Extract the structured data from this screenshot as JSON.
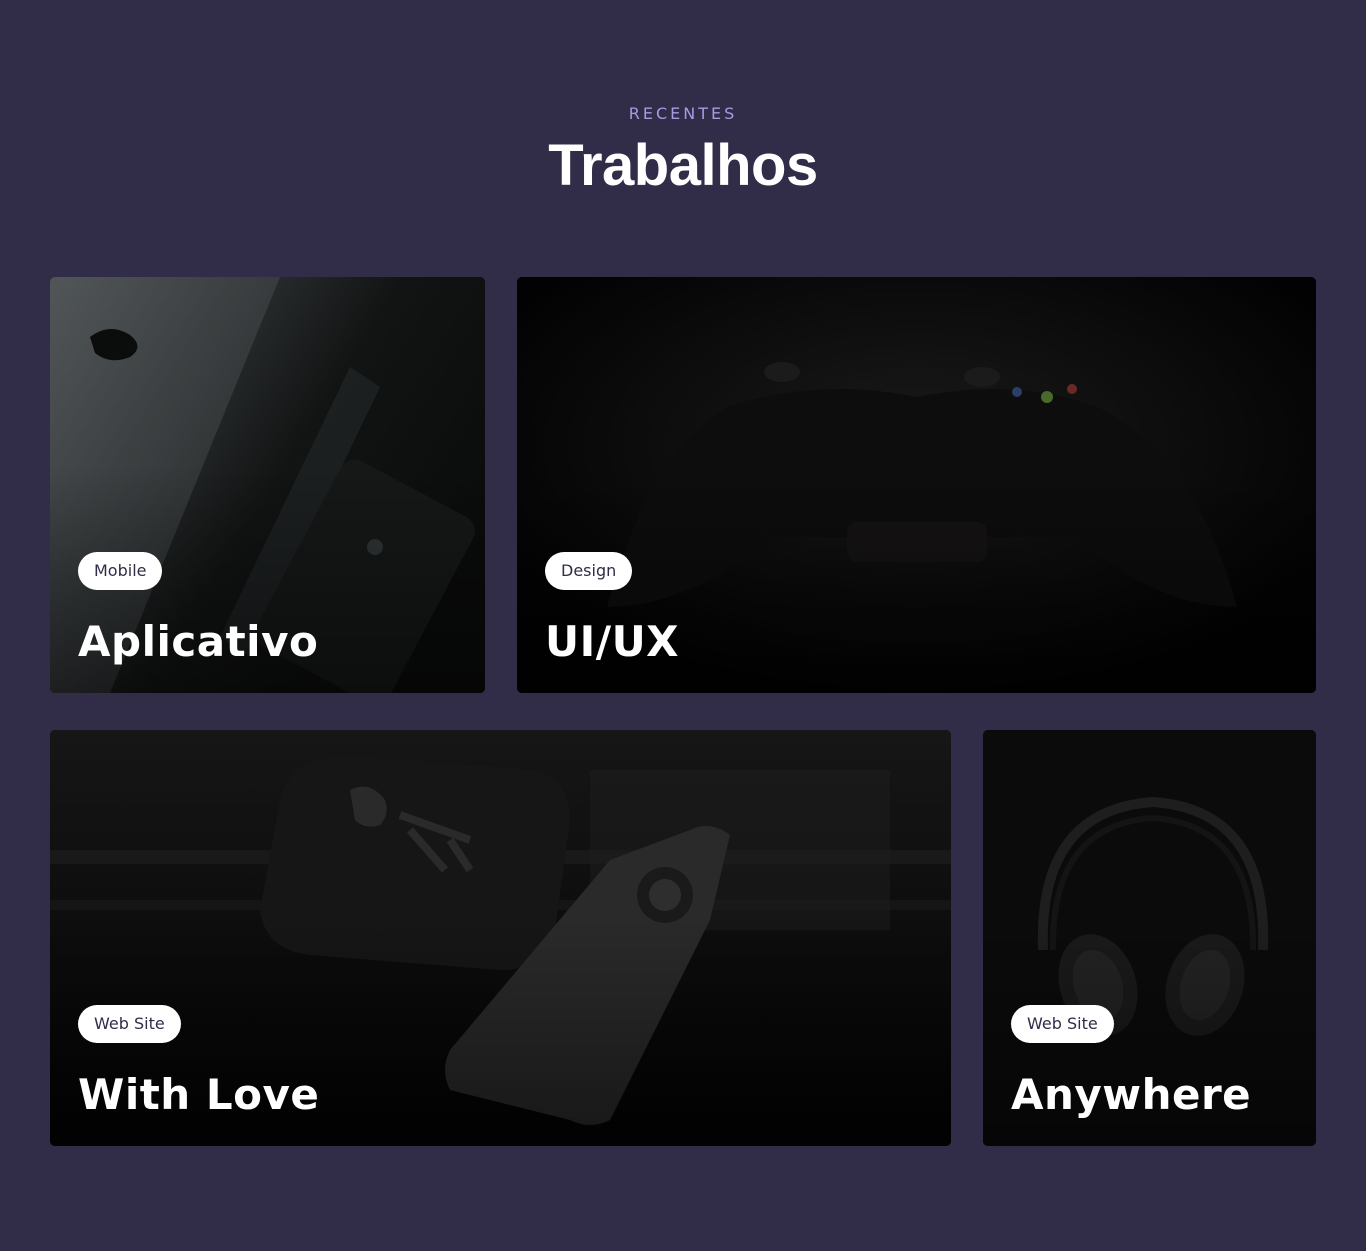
{
  "section": {
    "eyebrow": "RECENTES",
    "title": "Trabalhos"
  },
  "projects": [
    {
      "tag": "Mobile",
      "title": "Aplicativo",
      "image": "apple-devices-image"
    },
    {
      "tag": "Design",
      "title": "UI/UX",
      "image": "game-controller-image"
    },
    {
      "tag": "Web Site",
      "title": "With Love",
      "image": "apple-tv-remote-image"
    },
    {
      "tag": "Web Site",
      "title": "Anywhere",
      "image": "headphones-image"
    }
  ],
  "colors": {
    "background": "#312c47",
    "eyebrow": "#a99ae0",
    "title": "#ffffff",
    "tag_background": "#ffffff",
    "tag_text": "#312c47"
  }
}
